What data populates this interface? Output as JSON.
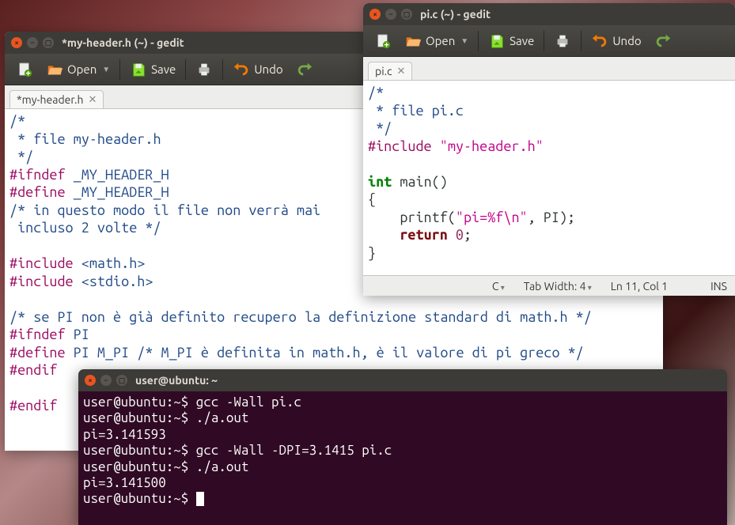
{
  "windows": {
    "gedit1": {
      "title": "*my-header.h (~) - gedit",
      "tab_label": "*my-header.h",
      "toolbar": {
        "open": "Open",
        "save": "Save",
        "undo": "Undo"
      }
    },
    "gedit2": {
      "title": "pi.c (~) - gedit",
      "tab_label": "pi.c",
      "toolbar": {
        "open": "Open",
        "save": "Save",
        "undo": "Undo"
      },
      "status": {
        "lang": "C",
        "tabwidth_label": "Tab Width:",
        "tabwidth_value": "4",
        "pos": "Ln 11, Col 1",
        "ins": "INS"
      }
    },
    "terminal": {
      "title": "user@ubuntu: ~",
      "prompt": "user@ubuntu:~$",
      "lines": [
        "user@ubuntu:~$ gcc -Wall pi.c",
        "user@ubuntu:~$ ./a.out",
        "pi=3.141593",
        "user@ubuntu:~$ gcc -Wall -DPI=3.1415 pi.c",
        "user@ubuntu:~$ ./a.out",
        "pi=3.141500",
        "user@ubuntu:~$ "
      ]
    }
  },
  "code": {
    "header": {
      "c1": "/*",
      "c2": " * file my-header.h",
      "c3": " */",
      "l4a": "#ifndef ",
      "l4b": "_MY_HEADER_H",
      "l5a": "#define ",
      "l5b": "_MY_HEADER_H",
      "c6": "/* in questo modo il file non verrà mai",
      "c7": " incluso 2 volte */",
      "l9a": "#include ",
      "l9b": "<math.h>",
      "l10a": "#include ",
      "l10b": "<stdio.h>",
      "c12": "/* se PI non è già definito recupero la definizione standard di math.h */",
      "l13a": "#ifndef ",
      "l13b": "PI",
      "l14a": "#define ",
      "l14b": "PI M_PI ",
      "c14": "/* M_PI è definita in math.h, è il valore di pi greco */",
      "l15": "#endif",
      "l17": "#endif"
    },
    "pi": {
      "c1": "/*",
      "c2": " * file pi.c",
      "c3": " */",
      "l4a": "#include ",
      "l4b": "\"my-header.h\"",
      "l6a": "int",
      "l6b": " main()",
      "l7": "{",
      "l8a": "    printf(",
      "l8b": "\"pi=%f\\n\"",
      "l8c": ", PI);",
      "l9a": "    ",
      "l9b": "return",
      "l9c": " ",
      "l9d": "0",
      "l9e": ";",
      "l10": "}"
    }
  }
}
